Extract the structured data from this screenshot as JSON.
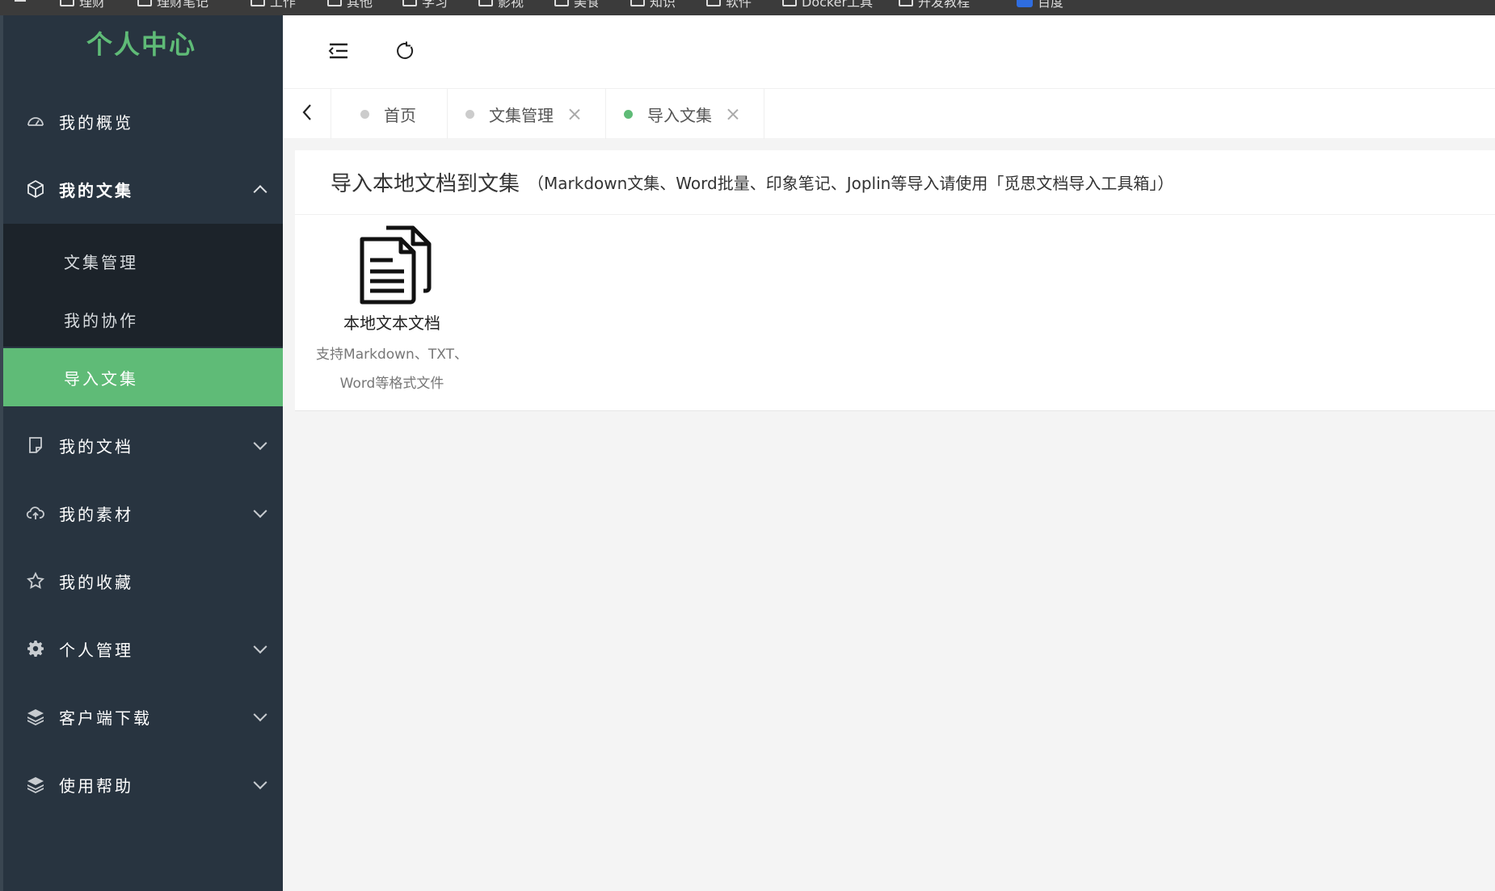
{
  "browser": {
    "bookmarks": [
      "理财",
      "理财笔记",
      "工作",
      "其他",
      "学习",
      "影视",
      "美食",
      "知识",
      "软件",
      "Docker工具",
      "开发教程",
      "百度"
    ]
  },
  "sidebar": {
    "logo": "个人中心",
    "items": [
      {
        "label": "我的概览",
        "icon": "dashboard-icon"
      },
      {
        "label": "我的文集",
        "icon": "cube-icon",
        "expanded": true
      },
      {
        "label": "我的文档",
        "icon": "note-icon"
      },
      {
        "label": "我的素材",
        "icon": "cloud-upload-icon"
      },
      {
        "label": "我的收藏",
        "icon": "star-icon"
      },
      {
        "label": "个人管理",
        "icon": "gear-icon"
      },
      {
        "label": "客户端下载",
        "icon": "layers-icon"
      },
      {
        "label": "使用帮助",
        "icon": "layers-icon"
      }
    ],
    "submenu": [
      {
        "label": "文集管理"
      },
      {
        "label": "我的协作"
      },
      {
        "label": "导入文集",
        "active": true
      }
    ]
  },
  "header": {
    "menu_toggle_icon": "menu-fold-icon",
    "refresh_icon": "refresh-icon"
  },
  "tabs": [
    {
      "label": "首页",
      "closable": false
    },
    {
      "label": "文集管理",
      "closable": true
    },
    {
      "label": "导入文集",
      "closable": true,
      "active": true
    }
  ],
  "card": {
    "title": "导入本地文档到文集",
    "note": "（Markdown文集、Word批量、印象笔记、Joplin等导入请使用「觅思文档导入工具箱」）",
    "option": {
      "title": "本地文本文档",
      "desc_line1": "支持Markdown、TXT、",
      "desc_line2": "Word等格式文件"
    }
  },
  "colors": {
    "accent": "#5fbb77",
    "sidebar_bg": "#283440",
    "submenu_bg": "#1c232a"
  }
}
